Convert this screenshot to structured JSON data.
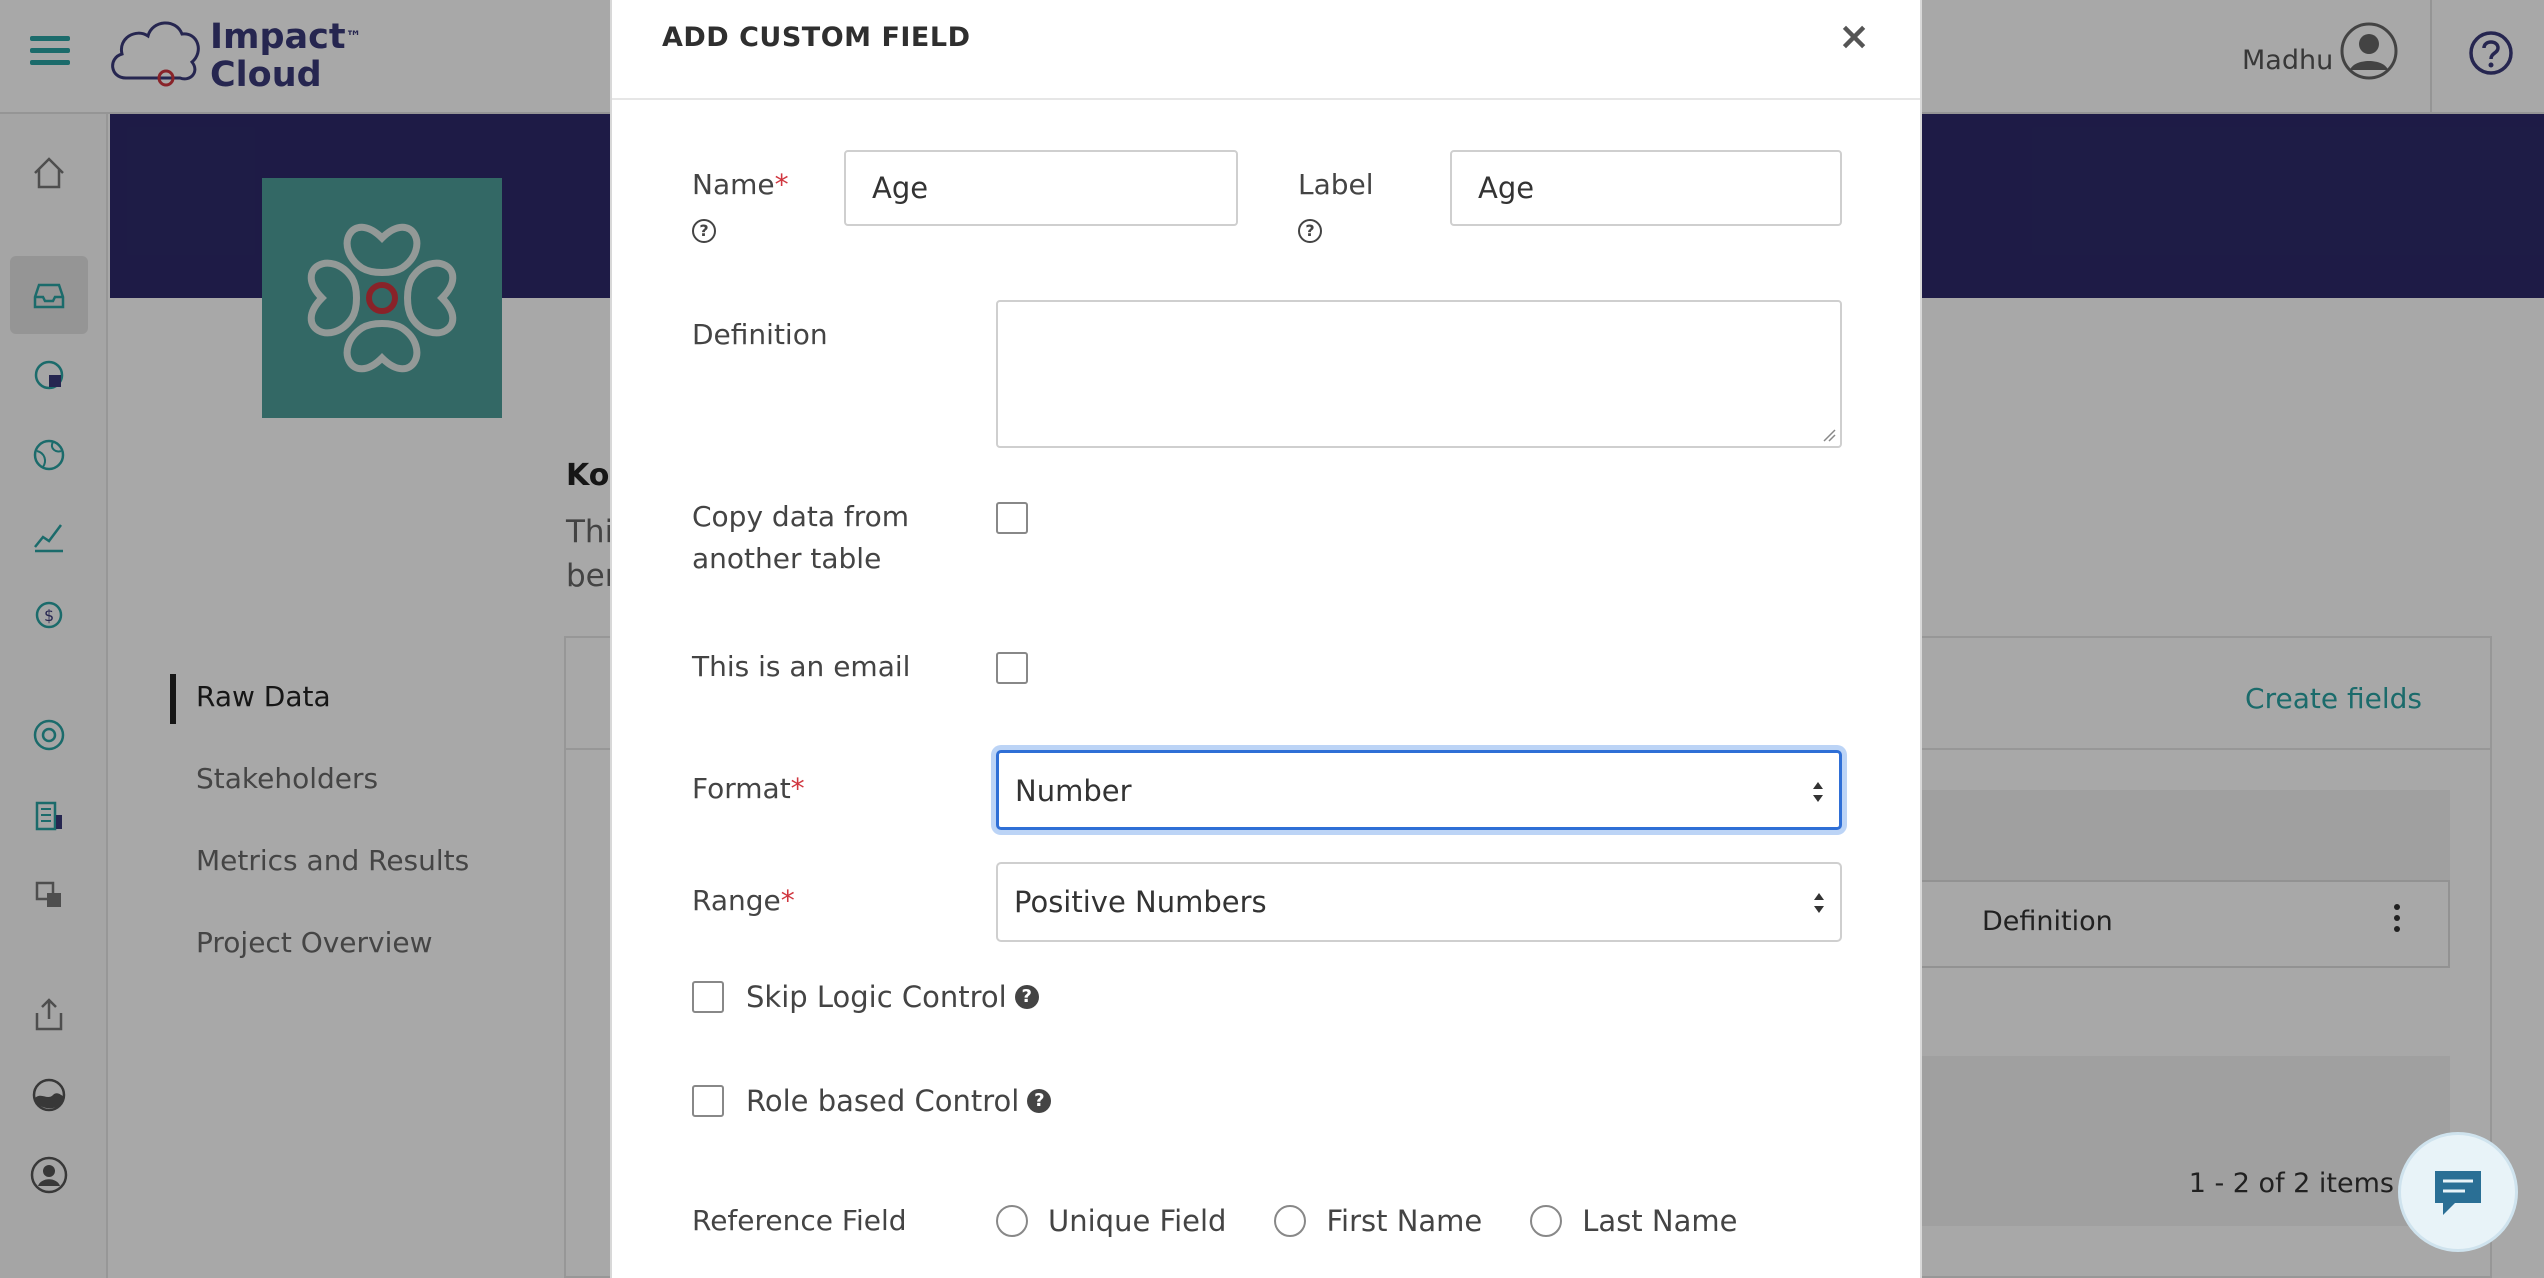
{
  "header": {
    "logo_line1": "Impact",
    "logo_line2": "Cloud",
    "logo_tm": "™",
    "user_name": "Madhu"
  },
  "project": {
    "title_fragment": "Kol",
    "desc_line1": "Thi",
    "desc_line2": "ber"
  },
  "left_nav": [
    {
      "label": "Raw Data",
      "active": true
    },
    {
      "label": "Stakeholders",
      "active": false
    },
    {
      "label": "Metrics and Results",
      "active": false
    },
    {
      "label": "Project Overview",
      "active": false
    }
  ],
  "content": {
    "create_fields": "Create fields",
    "column_definition": "Definition",
    "pager": "1 - 2 of 2 items"
  },
  "modal": {
    "title": "ADD CUSTOM FIELD",
    "close": "×",
    "name_label": "Name",
    "name_value": "Age",
    "label_label": "Label",
    "label_value": "Age",
    "definition_label": "Definition",
    "definition_value": "",
    "copy_label_line1": "Copy data from",
    "copy_label_line2": "another table",
    "email_label": "This is an email",
    "format_label": "Format",
    "format_value": "Number",
    "range_label": "Range",
    "range_value": "Positive Numbers",
    "skip_logic_label": "Skip Logic Control",
    "role_based_label": "Role based Control",
    "reference_label": "Reference Field",
    "reference_options": [
      "Unique Field",
      "First Name",
      "Last Name"
    ],
    "required_mark": "*",
    "info_mark": "?"
  },
  "colors": {
    "accent": "#2aa3a3",
    "banner": "#2e2a6b",
    "required": "#d0363f",
    "focus": "#2f6fd6"
  }
}
